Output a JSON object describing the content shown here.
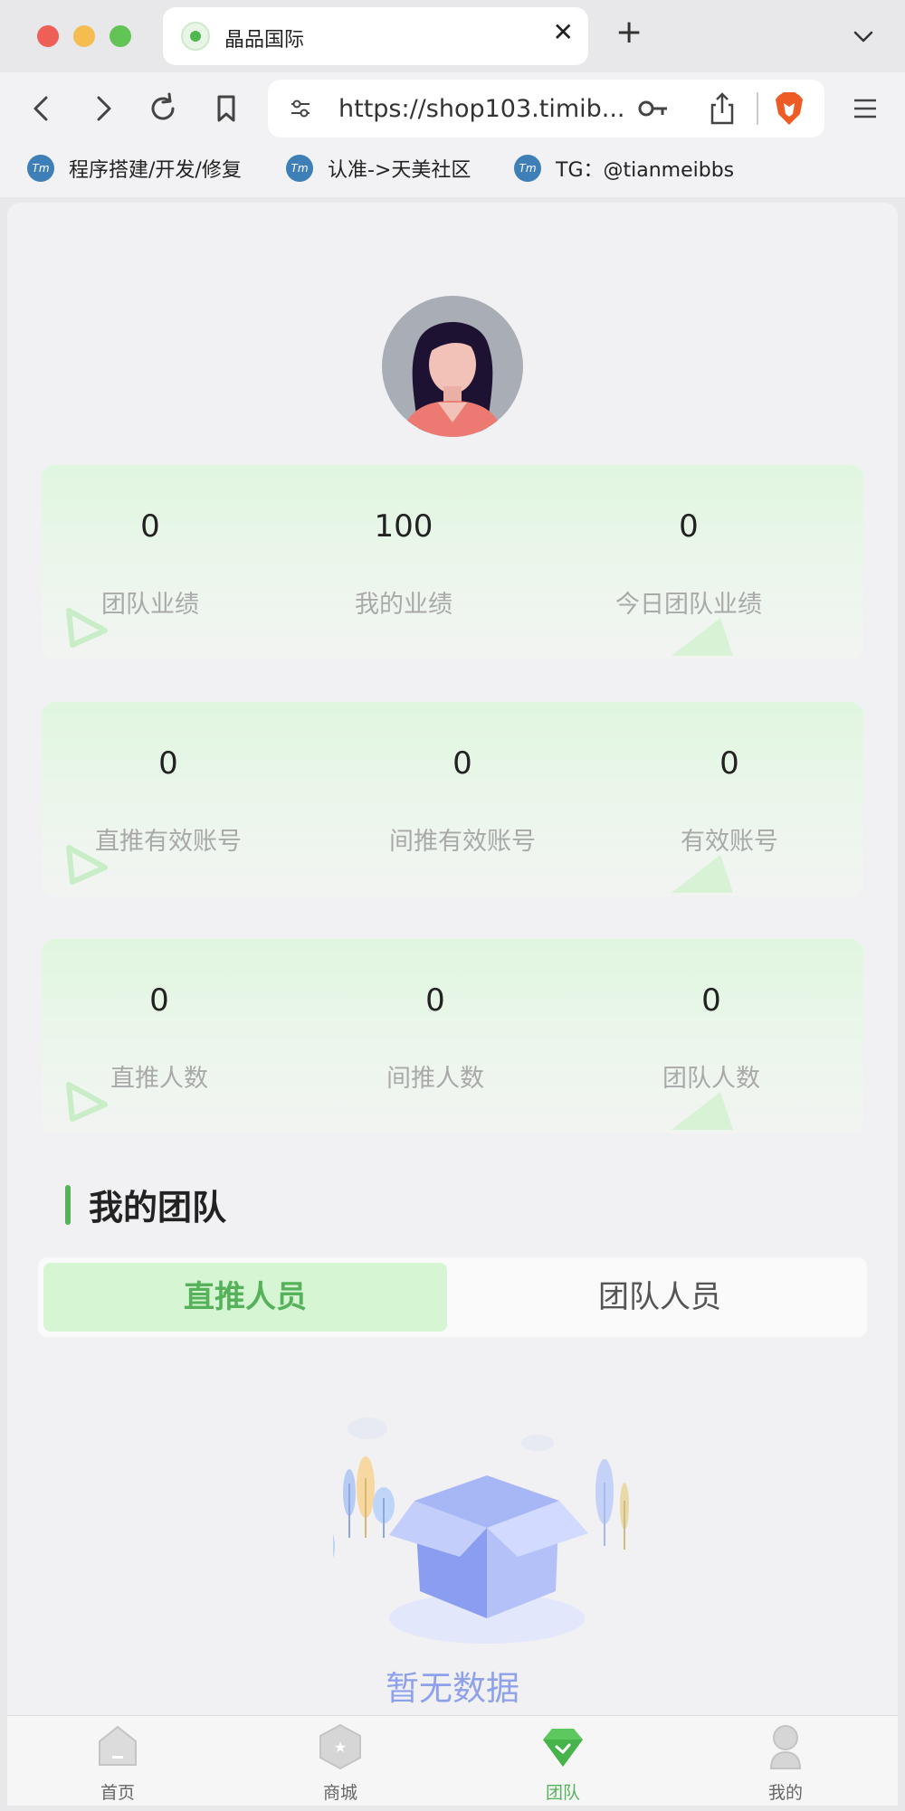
{
  "browser": {
    "tab_title": "晶品国际",
    "url": "https://shop103.timib...",
    "bookmarks": [
      {
        "icon_text": "Tm",
        "label": "程序搭建/开发/修复"
      },
      {
        "icon_text": "Tm",
        "label": "认准->天美社区"
      },
      {
        "icon_text": "Tm",
        "label": "TG：@tianmeibbs"
      }
    ]
  },
  "stats": [
    [
      {
        "value": "0",
        "label": "团队业绩"
      },
      {
        "value": "100",
        "label": "我的业绩"
      },
      {
        "value": "0",
        "label": "今日团队业绩"
      }
    ],
    [
      {
        "value": "0",
        "label": "直推有效账号"
      },
      {
        "value": "0",
        "label": "间推有效账号"
      },
      {
        "value": "0",
        "label": "有效账号"
      }
    ],
    [
      {
        "value": "0",
        "label": "直推人数"
      },
      {
        "value": "0",
        "label": "间推人数"
      },
      {
        "value": "0",
        "label": "团队人数"
      }
    ]
  ],
  "team": {
    "title": "我的团队",
    "tabs": [
      {
        "label": "直推人员",
        "active": true
      },
      {
        "label": "团队人员",
        "active": false
      }
    ],
    "empty_text": "暂无数据"
  },
  "bottom_nav": [
    {
      "label": "首页",
      "icon": "home-icon"
    },
    {
      "label": "商城",
      "icon": "shop-icon"
    },
    {
      "label": "团队",
      "icon": "team-icon",
      "active": true
    },
    {
      "label": "我的",
      "icon": "profile-icon"
    }
  ],
  "colors": {
    "accent": "#55b25a",
    "empty_text": "#8ea1ea",
    "label_gray": "#a9a9a9"
  }
}
